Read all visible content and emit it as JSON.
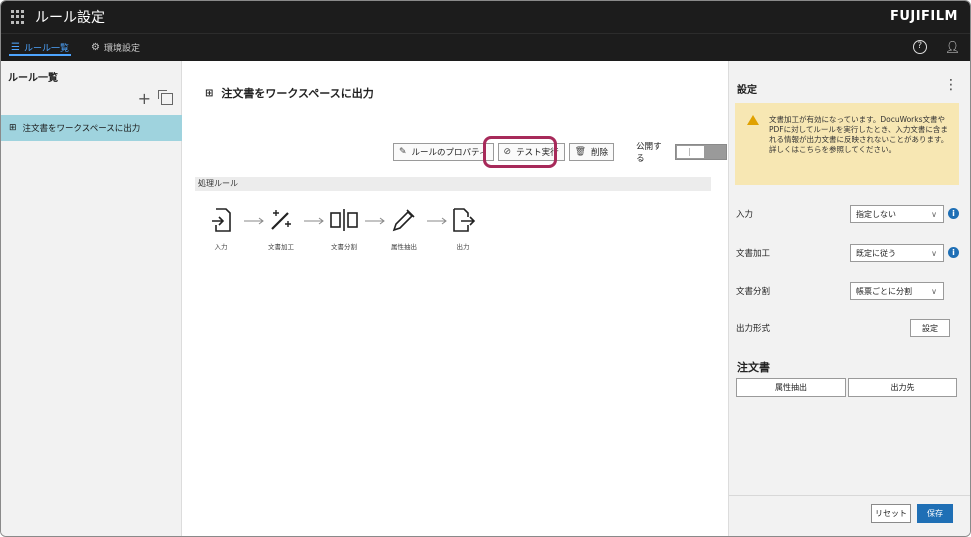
{
  "app": {
    "title": "ルール設定",
    "brand": "FUJIFILM"
  },
  "nav": {
    "tabs": [
      {
        "label": "ルール一覧",
        "icon": "list-icon",
        "active": true
      },
      {
        "label": "環境設定",
        "icon": "gear-icon",
        "active": false
      }
    ],
    "help_icon": "help-icon",
    "user_icon": "user-icon"
  },
  "left": {
    "title": "ルール一覧",
    "add_icon": "plus-icon",
    "copy_icon": "copy-icon",
    "items": [
      {
        "label": "注文書をワークスペースに出力",
        "selected": true
      }
    ]
  },
  "center": {
    "rule_title": "注文書をワークスペースに出力",
    "toolbar": {
      "properties_label": "ルールのプロパティ",
      "test_label": "テスト実行",
      "delete_label": "削除",
      "publish_label": "公開する",
      "publish_on": false
    },
    "section_label": "処理ルール",
    "steps": [
      {
        "label": "入力",
        "icon": "input-icon"
      },
      {
        "label": "文書加工",
        "icon": "magic-wand-icon"
      },
      {
        "label": "文書分割",
        "icon": "split-icon"
      },
      {
        "label": "属性抽出",
        "icon": "eyedropper-icon"
      },
      {
        "label": "出力",
        "icon": "output-icon"
      }
    ]
  },
  "right": {
    "title": "設定",
    "warning": "文書加工が有効になっています。DocuWorks文書やPDFに対してルールを実行したとき、入力文書に含まれる情報が出力文書に反映されないことがあります。詳しくはこちらを参照してください。",
    "rows": [
      {
        "label": "入力",
        "value": "指定しない"
      },
      {
        "label": "文書加工",
        "value": "既定に従う"
      },
      {
        "label": "文書分割",
        "value": "帳票ごとに分割"
      },
      {
        "label": "出力形式",
        "button": "設定"
      }
    ],
    "order_title": "注文書",
    "attr_button": "属性抽出",
    "dest_button": "出力先",
    "reset_label": "リセット",
    "save_label": "保存"
  },
  "colors": {
    "accent": "#1f6fb5",
    "selected_row": "#9fd3de",
    "warning_bg": "#f7e7b3",
    "highlight": "#a72a5a"
  }
}
